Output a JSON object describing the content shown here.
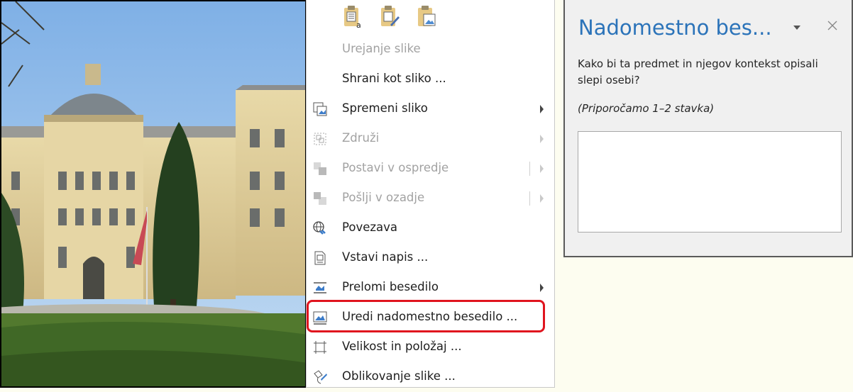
{
  "context_menu": {
    "items": [
      {
        "label": "Urejanje slike",
        "icon": "none",
        "disabled": true,
        "submenu": false
      },
      {
        "label": "Shrani kot sliko ...",
        "icon": "none",
        "disabled": false,
        "submenu": false
      },
      {
        "label": "Spremeni sliko",
        "icon": "change-picture-icon",
        "disabled": false,
        "submenu": true
      },
      {
        "label": "Združi",
        "icon": "group-icon",
        "disabled": true,
        "submenu": true
      },
      {
        "label": "Postavi v ospredje",
        "icon": "bring-forward-icon",
        "disabled": true,
        "submenu": true
      },
      {
        "label": "Pošlji v ozadje",
        "icon": "send-backward-icon",
        "disabled": true,
        "submenu": true
      },
      {
        "label": "Povezava",
        "icon": "link-globe-icon",
        "disabled": false,
        "submenu": false
      },
      {
        "label": "Vstavi napis ...",
        "icon": "caption-icon",
        "disabled": false,
        "submenu": false
      },
      {
        "label": "Prelomi besedilo",
        "icon": "wrap-text-icon",
        "disabled": false,
        "submenu": true
      },
      {
        "label": "Uredi nadomestno besedilo ...",
        "icon": "alt-text-icon",
        "disabled": false,
        "submenu": false
      },
      {
        "label": "Velikost in položaj ...",
        "icon": "size-position-icon",
        "disabled": false,
        "submenu": false
      },
      {
        "label": "Oblikovanje slike ...",
        "icon": "format-picture-icon",
        "disabled": false,
        "submenu": false
      }
    ],
    "highlight_color": "#e0141e"
  },
  "alt_text_pane": {
    "title": "Nadomestno bes...",
    "question": "Kako bi ta predmet in njegov kontekst opisali slepi osebi?",
    "hint": "(Priporočamo 1–2 stavka)",
    "input_value": "",
    "title_color": "#2b73b9"
  }
}
